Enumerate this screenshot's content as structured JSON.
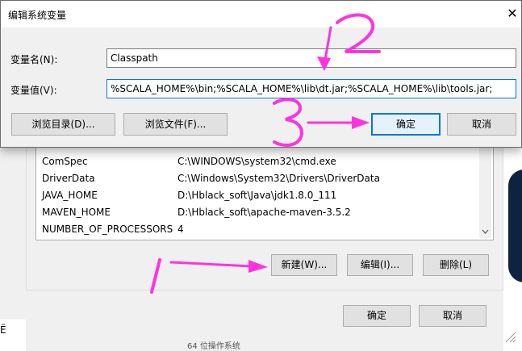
{
  "edit_dialog": {
    "title": "编辑系统变量",
    "close_glyph": "✕",
    "name_label": "变量名(N):",
    "name_value": "Classpath",
    "value_label": "变量值(V):",
    "value_value": "%SCALA_HOME%\\bin;%SCALA_HOME%\\lib\\dt.jar;%SCALA_HOME%\\lib\\tools.jar;",
    "browse_dir_button": "浏览目录(D)...",
    "browse_file_button": "浏览文件(F)...",
    "ok_button": "确定",
    "cancel_button": "取消"
  },
  "env_dialog": {
    "rows": [
      {
        "name": "ComSpec",
        "value": "C:\\WINDOWS\\system32\\cmd.exe"
      },
      {
        "name": "DriverData",
        "value": "C:\\Windows\\System32\\Drivers\\DriverData"
      },
      {
        "name": "JAVA_HOME",
        "value": "D:\\Hblack_soft\\Java\\jdk1.8.0_111"
      },
      {
        "name": "MAVEN_HOME",
        "value": "D:\\Hblack_soft\\apache-maven-3.5.2"
      },
      {
        "name": "NUMBER_OF_PROCESSORS",
        "value": "4"
      }
    ],
    "new_button": "新建(W)...",
    "edit_button": "编辑(I)...",
    "delete_button": "删除(L)",
    "ok_button": "确定",
    "cancel_button": "取消",
    "left_fragment": "Ë",
    "bottom_text": "64 位操作系统"
  },
  "annotations": {
    "num_1": "1",
    "num_2": "2",
    "num_3": "3",
    "color": "#ff33dd"
  }
}
